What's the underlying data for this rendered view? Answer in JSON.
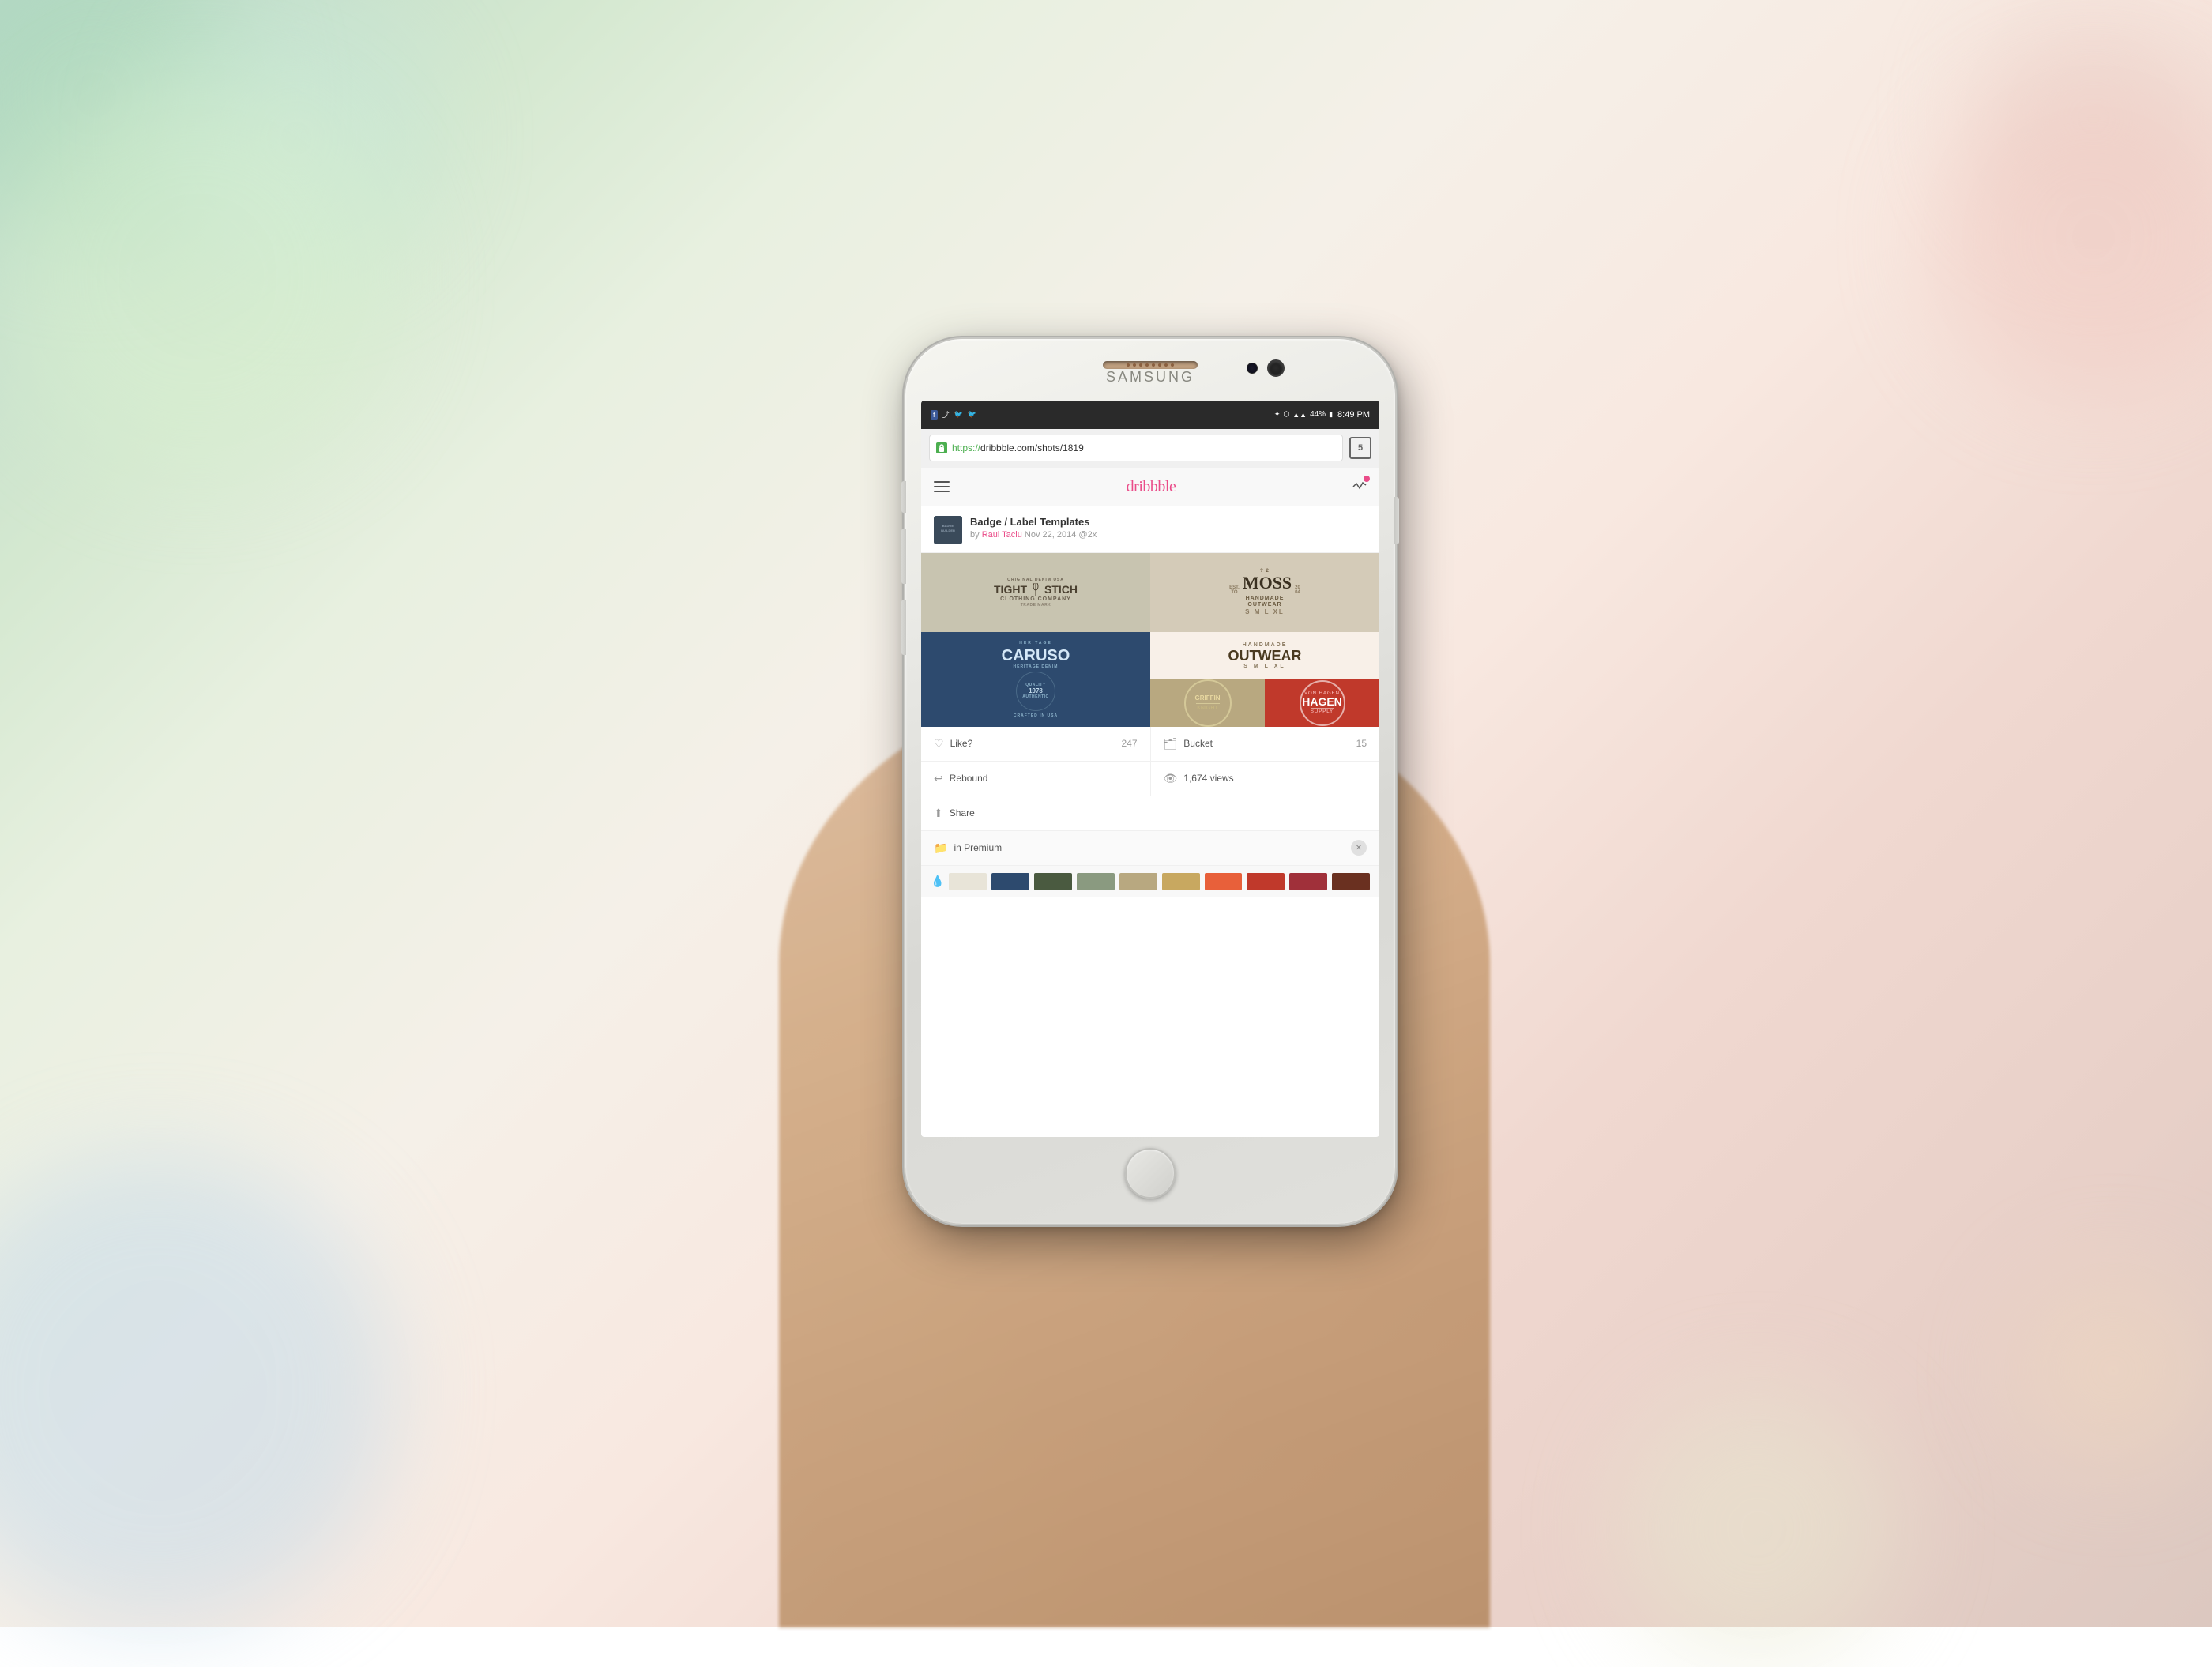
{
  "background": {
    "colors": [
      "#b8d8c8",
      "#d4e8d0",
      "#f5f0e8",
      "#f8e8e0",
      "#e8d0c8"
    ]
  },
  "phone": {
    "brand": "SAMSUNG",
    "status_bar": {
      "time": "8:49 PM",
      "battery": "44%",
      "signal_icons": "▪▪▪"
    },
    "url_bar": {
      "protocol": "https://",
      "url": "dribbble.com/shots/1819",
      "tabs_count": "5",
      "secure": true
    },
    "dribbble_header": {
      "logo": "dribbble"
    },
    "shot": {
      "title": "Badge / Label Templates",
      "author": "Raul Taciu",
      "date": "Nov 22, 2014",
      "retina": "@2x",
      "avatar_text": "BADGE BUILDER"
    },
    "actions": {
      "like_label": "Like?",
      "like_count": "247",
      "bucket_label": "Bucket",
      "bucket_count": "15",
      "rebound_label": "Rebound",
      "views_label": "1,674 views",
      "share_label": "Share",
      "premium_label": "in Premium"
    },
    "palette": {
      "colors": [
        "#e8e4d8",
        "#2d4a6e",
        "#4a5a40",
        "#8a9a80",
        "#b8a880",
        "#c8a860",
        "#e8603a",
        "#c0392b",
        "#a0303a",
        "#6a3020"
      ]
    },
    "badges": {
      "tight_stich": {
        "line1": "ORIGINAL DENIM USA",
        "line2": "TIGHT",
        "line3": "STICH",
        "line4": "CLOTHING COMPANY",
        "line5": "TRADE MARK"
      },
      "moss": {
        "number": "?",
        "est": "EST.",
        "to": "TO",
        "name": "MOSS",
        "year1": "20",
        "year2": "04",
        "subtitle1": "HANDMADE",
        "subtitle2": "OUTWEAR",
        "sizes": "S  M  L  XL"
      },
      "caruso": {
        "name": "CARUSO",
        "sub1": "HERITAGE DENIM",
        "sub2": "CRAFTED IN USA"
      },
      "handmade": {
        "line1": "HANDMADE",
        "line2": "OUTWEAR"
      },
      "griffin": {
        "name": "GRIFFIN",
        "sub": "KNIGHT"
      },
      "hagen": {
        "pre": "HAGEN",
        "sub": "SUPPLY"
      }
    }
  }
}
